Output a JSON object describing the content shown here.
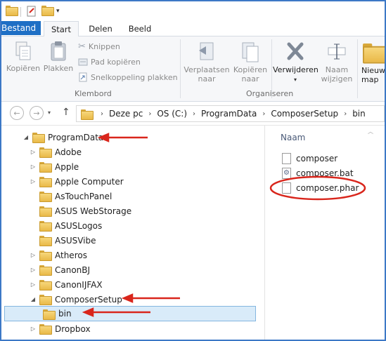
{
  "ribbon": {
    "tabs": [
      "Bestand",
      "Start",
      "Delen",
      "Beeld"
    ],
    "groups": {
      "klembord": {
        "label": "Klembord",
        "copy": "Kopiëren",
        "paste": "Plakken",
        "cut": "Knippen",
        "copy_path": "Pad kopiëren",
        "paste_shortcut": "Snelkoppeling plakken"
      },
      "organiseren": {
        "label": "Organiseren",
        "move_to": "Verplaatsen naar",
        "copy_to": "Kopiëren naar",
        "delete": "Verwijderen",
        "rename": "Naam wijzigen"
      },
      "new_folder": "Nieuwe map"
    }
  },
  "address": {
    "crumbs": [
      "Deze pc",
      "OS (C:)",
      "ProgramData",
      "ComposerSetup",
      "bin"
    ]
  },
  "tree": [
    {
      "label": "ProgramData",
      "expanded": true
    },
    {
      "label": "Adobe"
    },
    {
      "label": "Apple"
    },
    {
      "label": "Apple Computer"
    },
    {
      "label": "AsTouchPanel"
    },
    {
      "label": "ASUS WebStorage"
    },
    {
      "label": "ASUSLogos"
    },
    {
      "label": "ASUSVibe"
    },
    {
      "label": "Atheros"
    },
    {
      "label": "CanonBJ"
    },
    {
      "label": "CanonIJFAX"
    },
    {
      "label": "ComposerSetup",
      "expanded": true
    },
    {
      "label": "bin",
      "selected": true
    },
    {
      "label": "Dropbox"
    }
  ],
  "files": {
    "column": "Naam",
    "items": [
      "composer",
      "composer.bat",
      "composer.phar"
    ]
  },
  "colors": {
    "accent": "#1e6fc5",
    "annotation": "#d9261c",
    "selection": "#d9ebf9"
  }
}
